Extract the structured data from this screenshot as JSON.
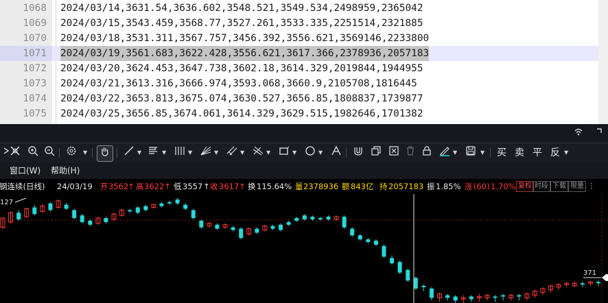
{
  "editor": {
    "lines": [
      {
        "num": "1068",
        "text": "2024/03/14,3631.54,3636.602,3548.521,3549.534,2498959,2365042"
      },
      {
        "num": "1069",
        "text": "2024/03/15,3543.459,3568.77,3527.261,3533.335,2251514,2321885"
      },
      {
        "num": "1070",
        "text": "2024/03/18,3531.311,3567.757,3456.392,3556.621,3569146,2233800"
      },
      {
        "num": "1071",
        "text": "2024/03/19,3561.683,3622.428,3556.621,3617.366,2378936,2057183"
      },
      {
        "num": "1072",
        "text": "2024/03/20,3624.453,3647.738,3602.18,3614.329,2019844,1944955"
      },
      {
        "num": "1073",
        "text": "2024/03/21,3613.316,3666.974,3593.068,3660.9,2105708,1816445"
      },
      {
        "num": "1074",
        "text": "2024/03/22,3653.813,3675.074,3630.527,3656.85,1808837,1739877"
      },
      {
        "num": "1075",
        "text": "2024/03/25,3656.85,3674.061,3614.329,3629.515,1982646,1701382"
      }
    ],
    "current_line_index": 3
  },
  "menu": {
    "window": "窗口(W)",
    "help": "帮助(H)"
  },
  "toolbar": {
    "trade_buy": "买",
    "trade_sell": "卖",
    "trade_flat": "平",
    "trade_reverse": "反"
  },
  "info": {
    "name": "钢连续(日线)",
    "date": "24/03/19",
    "open_label": "开",
    "open": "3562",
    "high_label": "高",
    "high": "3622",
    "low_label": "低",
    "low": "3557",
    "close_label": "收",
    "close": "3617",
    "turnover_label": "换",
    "turnover": "115.64%",
    "volume_label": "量",
    "volume": "2378936",
    "amount_label": "额",
    "amount": "843亿",
    "oi_label": "持",
    "oi": "2057183",
    "amplitude_label": "振",
    "amplitude": "1.85%",
    "change_label": "涨",
    "change_period": "(60)",
    "change": "1.70%",
    "btn_right": "复权",
    "btn_period": "时段",
    "btn_download": "下载",
    "btn_limit": "限量"
  },
  "chart_data": {
    "type": "candlestick",
    "y_axis_label_left": "127",
    "y_axis_label_right": "371",
    "candles": [
      {
        "o": 44,
        "c": 30,
        "h": 46,
        "l": 29
      },
      {
        "o": 36,
        "c": 22,
        "h": 38,
        "l": 20
      },
      {
        "o": 22,
        "c": 32,
        "h": 34,
        "l": 18
      },
      {
        "o": 28,
        "c": 16,
        "h": 30,
        "l": 14
      },
      {
        "o": 14,
        "c": 24,
        "h": 26,
        "l": 10
      },
      {
        "o": 20,
        "c": 12,
        "h": 22,
        "l": 9
      },
      {
        "o": 8,
        "c": 18,
        "h": 20,
        "l": 6
      },
      {
        "o": 14,
        "c": 4,
        "h": 16,
        "l": 2
      },
      {
        "o": 10,
        "c": 16,
        "h": 18,
        "l": 7
      },
      {
        "o": 18,
        "c": 30,
        "h": 32,
        "l": 16
      },
      {
        "o": 26,
        "c": 36,
        "h": 38,
        "l": 24
      },
      {
        "o": 34,
        "c": 40,
        "h": 42,
        "l": 32
      },
      {
        "o": 38,
        "c": 30,
        "h": 40,
        "l": 28
      },
      {
        "o": 30,
        "c": 36,
        "h": 38,
        "l": 28
      },
      {
        "o": 32,
        "c": 24,
        "h": 34,
        "l": 22
      },
      {
        "o": 26,
        "c": 18,
        "h": 28,
        "l": 16
      },
      {
        "o": 18,
        "c": 20,
        "h": 22,
        "l": 16
      },
      {
        "o": 14,
        "c": 22,
        "h": 24,
        "l": 12
      },
      {
        "o": 12,
        "c": 18,
        "h": 20,
        "l": 10
      },
      {
        "o": 14,
        "c": 10,
        "h": 16,
        "l": 8
      },
      {
        "o": 8,
        "c": 12,
        "h": 14,
        "l": 6
      },
      {
        "o": 6,
        "c": 8,
        "h": 10,
        "l": 4
      },
      {
        "o": 2,
        "c": 8,
        "h": 10,
        "l": 0
      },
      {
        "o": 10,
        "c": 16,
        "h": 18,
        "l": 8
      },
      {
        "o": 18,
        "c": 30,
        "h": 32,
        "l": 16
      },
      {
        "o": 34,
        "c": 44,
        "h": 46,
        "l": 32
      },
      {
        "o": 42,
        "c": 38,
        "h": 44,
        "l": 36
      },
      {
        "o": 40,
        "c": 46,
        "h": 48,
        "l": 38
      },
      {
        "o": 44,
        "c": 40,
        "h": 46,
        "l": 38
      },
      {
        "o": 44,
        "c": 48,
        "h": 50,
        "l": 42
      },
      {
        "o": 46,
        "c": 60,
        "h": 62,
        "l": 44
      },
      {
        "o": 54,
        "c": 46,
        "h": 56,
        "l": 44
      },
      {
        "o": 46,
        "c": 52,
        "h": 54,
        "l": 44
      },
      {
        "o": 48,
        "c": 42,
        "h": 50,
        "l": 40
      },
      {
        "o": 42,
        "c": 46,
        "h": 48,
        "l": 40
      },
      {
        "o": 40,
        "c": 48,
        "h": 50,
        "l": 38
      },
      {
        "o": 36,
        "c": 40,
        "h": 42,
        "l": 34
      },
      {
        "o": 30,
        "c": 34,
        "h": 36,
        "l": 28
      },
      {
        "o": 26,
        "c": 32,
        "h": 34,
        "l": 24
      },
      {
        "o": 28,
        "c": 32,
        "h": 34,
        "l": 26
      },
      {
        "o": 30,
        "c": 32,
        "h": 34,
        "l": 28
      },
      {
        "o": 28,
        "c": 32,
        "h": 34,
        "l": 26
      },
      {
        "o": 32,
        "c": 28,
        "h": 34,
        "l": 26
      },
      {
        "o": 28,
        "c": 44,
        "h": 46,
        "l": 26
      },
      {
        "o": 46,
        "c": 56,
        "h": 58,
        "l": 44
      },
      {
        "o": 56,
        "c": 62,
        "h": 64,
        "l": 54
      },
      {
        "o": 62,
        "c": 66,
        "h": 68,
        "l": 60
      },
      {
        "o": 64,
        "c": 70,
        "h": 72,
        "l": 62
      },
      {
        "o": 72,
        "c": 88,
        "h": 90,
        "l": 70
      },
      {
        "o": 90,
        "c": 98,
        "h": 100,
        "l": 86
      },
      {
        "o": 96,
        "c": 112,
        "h": 114,
        "l": 94
      },
      {
        "o": 108,
        "c": 124,
        "h": 126,
        "l": 106
      },
      {
        "o": 120,
        "c": 136,
        "h": 138,
        "l": 118
      },
      {
        "o": 132,
        "c": 134,
        "h": 140,
        "l": 130
      },
      {
        "o": 136,
        "c": 150,
        "h": 154,
        "l": 134
      },
      {
        "o": 150,
        "c": 144,
        "h": 156,
        "l": 142
      },
      {
        "o": 146,
        "c": 150,
        "h": 154,
        "l": 144
      },
      {
        "o": 148,
        "c": 154,
        "h": 158,
        "l": 146
      },
      {
        "o": 152,
        "c": 150,
        "h": 158,
        "l": 146
      },
      {
        "o": 148,
        "c": 152,
        "h": 156,
        "l": 146
      },
      {
        "o": 150,
        "c": 148,
        "h": 156,
        "l": 144
      },
      {
        "o": 150,
        "c": 146,
        "h": 154,
        "l": 144
      },
      {
        "o": 148,
        "c": 150,
        "h": 156,
        "l": 146
      },
      {
        "o": 146,
        "c": 148,
        "h": 154,
        "l": 144
      },
      {
        "o": 150,
        "c": 146,
        "h": 154,
        "l": 144
      },
      {
        "o": 146,
        "c": 148,
        "h": 154,
        "l": 144
      },
      {
        "o": 150,
        "c": 144,
        "h": 154,
        "l": 142
      },
      {
        "o": 146,
        "c": 140,
        "h": 150,
        "l": 138
      },
      {
        "o": 142,
        "c": 136,
        "h": 146,
        "l": 134
      },
      {
        "o": 138,
        "c": 132,
        "h": 142,
        "l": 130
      },
      {
        "o": 134,
        "c": 130,
        "h": 138,
        "l": 128
      },
      {
        "o": 130,
        "c": 128,
        "h": 134,
        "l": 126
      },
      {
        "o": 132,
        "c": 128,
        "h": 134,
        "l": 126
      },
      {
        "o": 128,
        "c": 130,
        "h": 134,
        "l": 126
      },
      {
        "o": 128,
        "c": 126,
        "h": 132,
        "l": 124
      },
      {
        "o": 126,
        "c": 128,
        "h": 132,
        "l": 124
      }
    ],
    "colors": {
      "up": "#ff3b3b",
      "down": "#27d8d8",
      "grid": "#8a1a1a",
      "crosshair": "#e8e8e8"
    }
  }
}
